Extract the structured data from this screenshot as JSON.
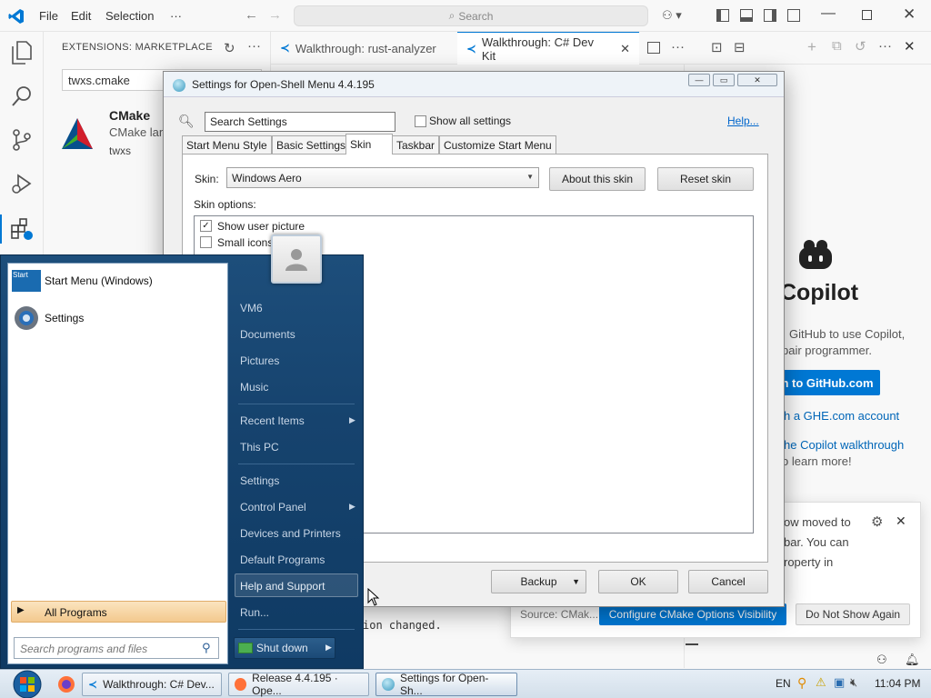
{
  "vscode": {
    "menu": [
      "File",
      "Edit",
      "Selection",
      "···"
    ],
    "search_placeholder": "Search",
    "sidebar_title": "EXTENSIONS: MARKETPLACE",
    "search_value": "twxs.cmake",
    "ext_name": "CMake",
    "ext_desc": "CMake lan",
    "ext_publisher": "twxs",
    "tabs": [
      "Walkthrough: rust-analyzer",
      "Walkthrough: C# Dev Kit"
    ],
    "copilot": {
      "title": "Copilot",
      "line1": "GitHub to use Copilot,",
      "line2": "pair programmer.",
      "signin": "n to GitHub.com",
      "ghe": "h a GHE.com account",
      "walk1": "he Copilot walkthrough",
      "walk2": "o learn more!"
    },
    "terminal_text": "ion changed.",
    "notification": {
      "line1": "ow moved to",
      "line2": "bar. You can",
      "line3": "roperty in",
      "source": "Source: CMak...",
      "btn_configure": "Configure CMake Options Visibility",
      "btn_dismiss": "Do Not Show Again"
    }
  },
  "dialog": {
    "title": "Settings for Open-Shell Menu 4.4.195",
    "search_value": "Search Settings",
    "show_all": "Show all settings",
    "help": "Help...",
    "tabs": [
      "Start Menu Style",
      "Basic Settings",
      "Skin",
      "Taskbar",
      "Customize Start Menu"
    ],
    "skin_label": "Skin:",
    "skin_value": "Windows Aero",
    "about_btn": "About this skin",
    "reset_btn": "Reset skin",
    "options_label": "Skin options:",
    "options": [
      {
        "label": "Show user picture",
        "checked": true
      },
      {
        "label": "Small icons",
        "checked": false
      }
    ],
    "backup_btn": "Backup",
    "ok_btn": "OK",
    "cancel_btn": "Cancel"
  },
  "start_menu": {
    "pinned": [
      {
        "label": "Start Menu (Windows)",
        "icon": "start-menu-icon"
      },
      {
        "label": "Settings",
        "icon": "gear-icon"
      }
    ],
    "all_programs": "All Programs",
    "search_placeholder": "Search programs and files",
    "right": [
      {
        "label": "VM6",
        "arrow": false
      },
      {
        "label": "Documents",
        "arrow": false
      },
      {
        "label": "Pictures",
        "arrow": false
      },
      {
        "label": "Music",
        "arrow": false
      },
      {
        "label": "Recent Items",
        "arrow": true
      },
      {
        "label": "This PC",
        "arrow": false
      },
      {
        "label": "Settings",
        "arrow": false
      },
      {
        "label": "Control Panel",
        "arrow": true
      },
      {
        "label": "Devices and Printers",
        "arrow": false
      },
      {
        "label": "Default Programs",
        "arrow": false
      },
      {
        "label": "Help and Support",
        "arrow": false
      },
      {
        "label": "Run...",
        "arrow": false
      }
    ],
    "shutdown": "Shut down"
  },
  "taskbar": {
    "items": [
      "Walkthrough: C# Dev...",
      "Release 4.4.195 · Ope...",
      "Settings for Open-Sh..."
    ],
    "lang": "EN",
    "time": "11:04 PM"
  },
  "colors": {
    "vscode_blue": "#0078d4",
    "start_blue": "#16436e",
    "accent_orange": "#f5d6a8"
  }
}
